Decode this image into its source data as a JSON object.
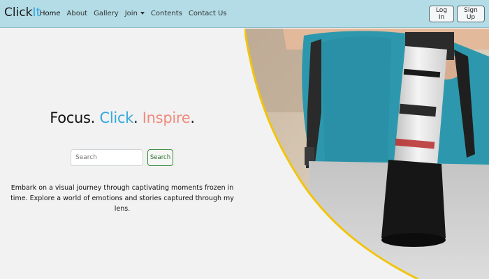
{
  "nav": {
    "brand": {
      "prefix": "Click",
      "accent": "It"
    },
    "links": [
      {
        "label": "Home"
      },
      {
        "label": "About"
      },
      {
        "label": "Gallery"
      },
      {
        "label": "Join"
      },
      {
        "label": "Contents"
      },
      {
        "label": "Contact Us"
      }
    ],
    "login_label": "Log In",
    "signup_label": "Sign Up"
  },
  "hero": {
    "headline": {
      "word1": "Focus.",
      "word2": "Click",
      "word3": "Inspire",
      "dot": "."
    },
    "search": {
      "placeholder": "Search",
      "button_label": "Search"
    },
    "description": "Embark on a visual journey through captivating moments frozen in time. Explore a world of emotions and stories captured through my lens."
  },
  "colors": {
    "navbar_bg": "#b3dce6",
    "accent_blue": "#35a9de",
    "accent_coral": "#ef8a7e",
    "accent_yellow": "#f1c40f",
    "search_green": "#3c8a3f"
  }
}
